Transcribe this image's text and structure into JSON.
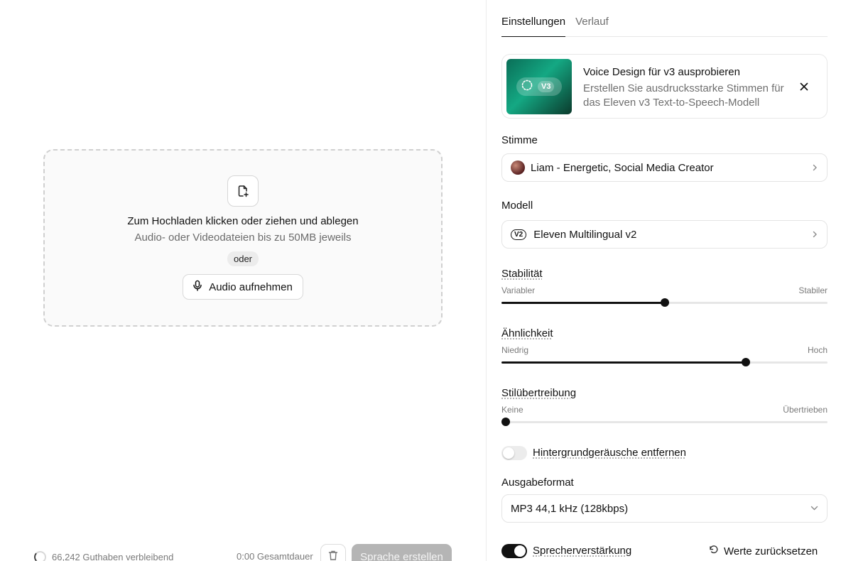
{
  "dropzone": {
    "title": "Zum Hochladen klicken oder ziehen und ablegen",
    "subtitle": "Audio- oder Videodateien bis zu 50MB jeweils",
    "or_label": "oder",
    "record_label": "Audio aufnehmen"
  },
  "footer": {
    "credits": "66,242 Guthaben verbleibend",
    "duration": "0:00 Gesamtdauer",
    "create_label": "Sprache erstellen"
  },
  "tabs": [
    {
      "label": "Einstellungen",
      "active": true
    },
    {
      "label": "Verlauf",
      "active": false
    }
  ],
  "promo": {
    "title": "Voice Design für v3 ausprobieren",
    "description": "Erstellen Sie ausdrucksstarke Stimmen für das Eleven v3 Text-to-Speech-Modell",
    "badge": "V3"
  },
  "voice": {
    "label": "Stimme",
    "value": "Liam - Energetic, Social Media Creator"
  },
  "model": {
    "label": "Modell",
    "badge": "V2",
    "value": "Eleven Multilingual v2"
  },
  "sliders": {
    "stability": {
      "label": "Stabilität",
      "min_label": "Variabler",
      "max_label": "Stabiler",
      "value": 0.5
    },
    "similarity": {
      "label": "Ähnlichkeit",
      "min_label": "Niedrig",
      "max_label": "Hoch",
      "value": 0.75
    },
    "style": {
      "label": "Stilübertreibung",
      "min_label": "Keine",
      "max_label": "Übertrieben",
      "value": 0.0
    }
  },
  "toggles": {
    "remove_noise": {
      "label": "Hintergrundgeräusche entfernen",
      "on": false
    },
    "speaker_boost": {
      "label": "Sprecherverstärkung",
      "on": true
    }
  },
  "output_format": {
    "label": "Ausgabeformat",
    "value": "MP3 44,1 kHz (128kbps)"
  },
  "reset_label": "Werte zurücksetzen",
  "colors": {
    "promo_gradient_start": "#0a6e57",
    "promo_gradient_mid": "#14a883",
    "create_button_disabled": "#b5b5b5"
  }
}
